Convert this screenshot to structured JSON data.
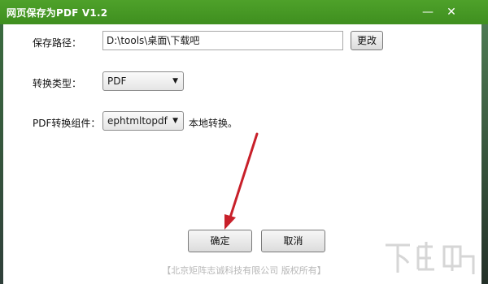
{
  "window": {
    "title": "网页保存为PDF  V1.2",
    "minimize_glyph": "—",
    "close_glyph": "✕"
  },
  "form": {
    "path_label": "保存路径：",
    "path_value": "D:\\tools\\桌面\\下载吧",
    "change_button": "更改",
    "type_label": "转换类型：",
    "type_value": "PDF",
    "component_label": "PDF转换组件：",
    "component_value": "ephtmltopdf",
    "component_note": "本地转换。"
  },
  "actions": {
    "ok": "确定",
    "cancel": "取消"
  },
  "footer": {
    "copyright": "【北京矩阵志诚科技有限公司 版权所有】"
  },
  "watermark": {
    "text": "下载吧"
  },
  "colors": {
    "titlebar": "#3f8f1f",
    "annotation_arrow": "#c8202a"
  },
  "icons": {
    "dropdown": "chevron-down-icon",
    "annotation": "red-arrow-icon"
  }
}
